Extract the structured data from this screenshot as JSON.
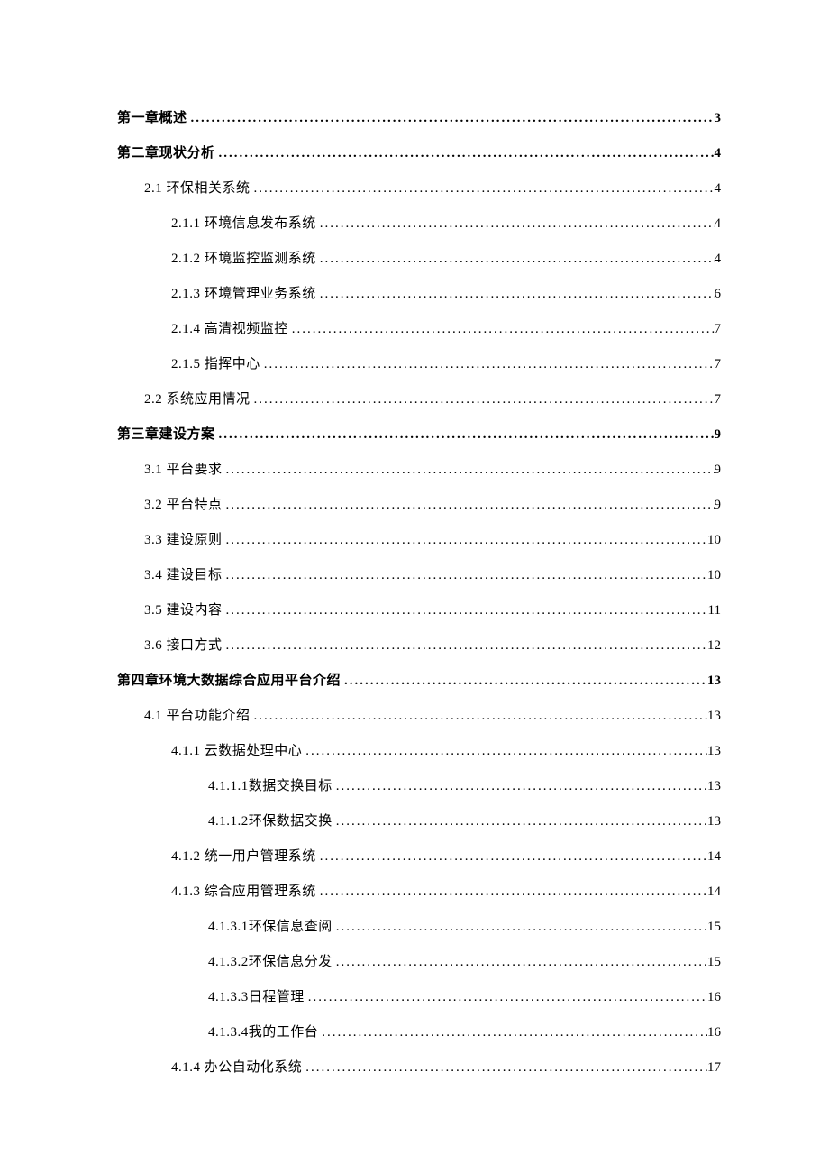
{
  "dots": "............................................................................................................................................",
  "toc": [
    {
      "level": 1,
      "title": "第一章概述",
      "page": "3"
    },
    {
      "level": 1,
      "title": "第二章现状分析",
      "page": "4"
    },
    {
      "level": 2,
      "title": "2.1 环保相关系统",
      "page": "4"
    },
    {
      "level": 3,
      "title": "2.1.1 环境信息发布系统",
      "page": "4"
    },
    {
      "level": 3,
      "title": "2.1.2 环境监控监测系统",
      "page": "4"
    },
    {
      "level": 3,
      "title": "2.1.3 环境管理业务系统",
      "page": "6"
    },
    {
      "level": 3,
      "title": "2.1.4 高清视频监控",
      "page": "7"
    },
    {
      "level": 3,
      "title": "2.1.5 指挥中心",
      "page": "7"
    },
    {
      "level": 2,
      "title": "2.2 系统应用情况",
      "page": "7"
    },
    {
      "level": 1,
      "title": "第三章建设方案",
      "page": "9"
    },
    {
      "level": 2,
      "title": "3.1 平台要求",
      "page": "9"
    },
    {
      "level": 2,
      "title": "3.2 平台特点",
      "page": "9"
    },
    {
      "level": 2,
      "title": "3.3 建设原则",
      "page": "10"
    },
    {
      "level": 2,
      "title": "3.4 建设目标",
      "page": "10"
    },
    {
      "level": 2,
      "title": "3.5 建设内容",
      "page": "11"
    },
    {
      "level": 2,
      "title": "3.6 接口方式",
      "page": "12"
    },
    {
      "level": 1,
      "title": "第四章环境大数据综合应用平台介绍",
      "page": "13"
    },
    {
      "level": 2,
      "title": "4.1 平台功能介绍",
      "page": "13"
    },
    {
      "level": 3,
      "title": "4.1.1 云数据处理中心",
      "page": "13"
    },
    {
      "level": 4,
      "title": "4.1.1.1数据交换目标",
      "page": "13"
    },
    {
      "level": 4,
      "title": "4.1.1.2环保数据交换",
      "page": "13"
    },
    {
      "level": 3,
      "title": "4.1.2 统一用户管理系统",
      "page": "14"
    },
    {
      "level": 3,
      "title": "4.1.3 综合应用管理系统",
      "page": "14"
    },
    {
      "level": 4,
      "title": "4.1.3.1环保信息查阅",
      "page": "15"
    },
    {
      "level": 4,
      "title": "4.1.3.2环保信息分发",
      "page": "15"
    },
    {
      "level": 4,
      "title": "4.1.3.3日程管理",
      "page": "16"
    },
    {
      "level": 4,
      "title": "4.1.3.4我的工作台",
      "page": "16"
    },
    {
      "level": 3,
      "title": "4.1.4 办公自动化系统",
      "page": "17"
    }
  ]
}
